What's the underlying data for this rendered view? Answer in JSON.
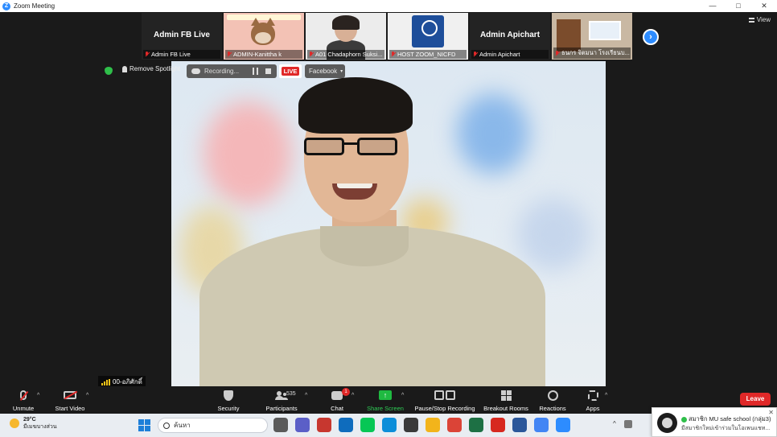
{
  "window": {
    "title": "Zoom Meeting",
    "app_icon_letter": "Z",
    "controls": [
      "—",
      "□",
      "✕"
    ]
  },
  "view_label": "View",
  "thumbnails": [
    {
      "big_name": "Admin FB Live",
      "label": "Admin FB Live",
      "muted": true
    },
    {
      "big_name": "",
      "label": "ADMIN-Kanittha k",
      "muted": true
    },
    {
      "big_name": "",
      "label": "A01 Chadaphorn Suksi...",
      "muted": true
    },
    {
      "big_name": "",
      "label": "HOST ZOOM_NICFD",
      "muted": true
    },
    {
      "big_name": "Admin Apichart",
      "label": "Admin Apichart",
      "muted": true
    },
    {
      "big_name": "",
      "label": "ธนกร จิตมนา โรงเรียนบ...",
      "muted": true
    }
  ],
  "next_page_icon": "›",
  "overlay": {
    "remove_spotlight": "Remove Spotlight",
    "recording": "Recording...",
    "live": "LIVE",
    "facebook": "Facebook",
    "facebook_caret": "▾"
  },
  "speaker_name": "00-อภิศักดิ์",
  "toolbar": {
    "unmute": "Unmute",
    "start_video": "Start Video",
    "security": "Security",
    "participants": "Participants",
    "participants_count": "535",
    "chat": "Chat",
    "chat_badge": "1",
    "share_screen": "Share Screen",
    "share_arrow": "↑",
    "pause_stop_recording": "Pause/Stop Recording",
    "breakout_rooms": "Breakout Rooms",
    "reactions": "Reactions",
    "apps": "Apps",
    "caret": "^",
    "leave": "Leave"
  },
  "taskbar": {
    "temp": "29°C",
    "weather_desc": "มีเมฆบางส่วน",
    "search_placeholder": "ค้นหา",
    "apps": [
      {
        "name": "task-view",
        "color": "#5a5a5a"
      },
      {
        "name": "teams",
        "color": "#5b5fc7"
      },
      {
        "name": "app-red",
        "color": "#c7372f"
      },
      {
        "name": "mail",
        "color": "#0f6cbd"
      },
      {
        "name": "line",
        "color": "#06c755"
      },
      {
        "name": "edge",
        "color": "#0c8ed9"
      },
      {
        "name": "store",
        "color": "#3a3a3a"
      },
      {
        "name": "explorer",
        "color": "#f2b41b"
      },
      {
        "name": "chrome",
        "color": "#db4437"
      },
      {
        "name": "excel",
        "color": "#1d7044"
      },
      {
        "name": "acrobat",
        "color": "#d7281f"
      },
      {
        "name": "word",
        "color": "#2b579a"
      },
      {
        "name": "chrome-2",
        "color": "#4285f4"
      },
      {
        "name": "zoom",
        "color": "#2d8cff"
      }
    ],
    "tray_caret": "^"
  },
  "notification": {
    "title": "สมาชิก MU safe school (กลุ่ม3)",
    "message": "มีสมาชิกใหม่เข้าร่วมในโอเพนแชท...",
    "close": "✕"
  }
}
